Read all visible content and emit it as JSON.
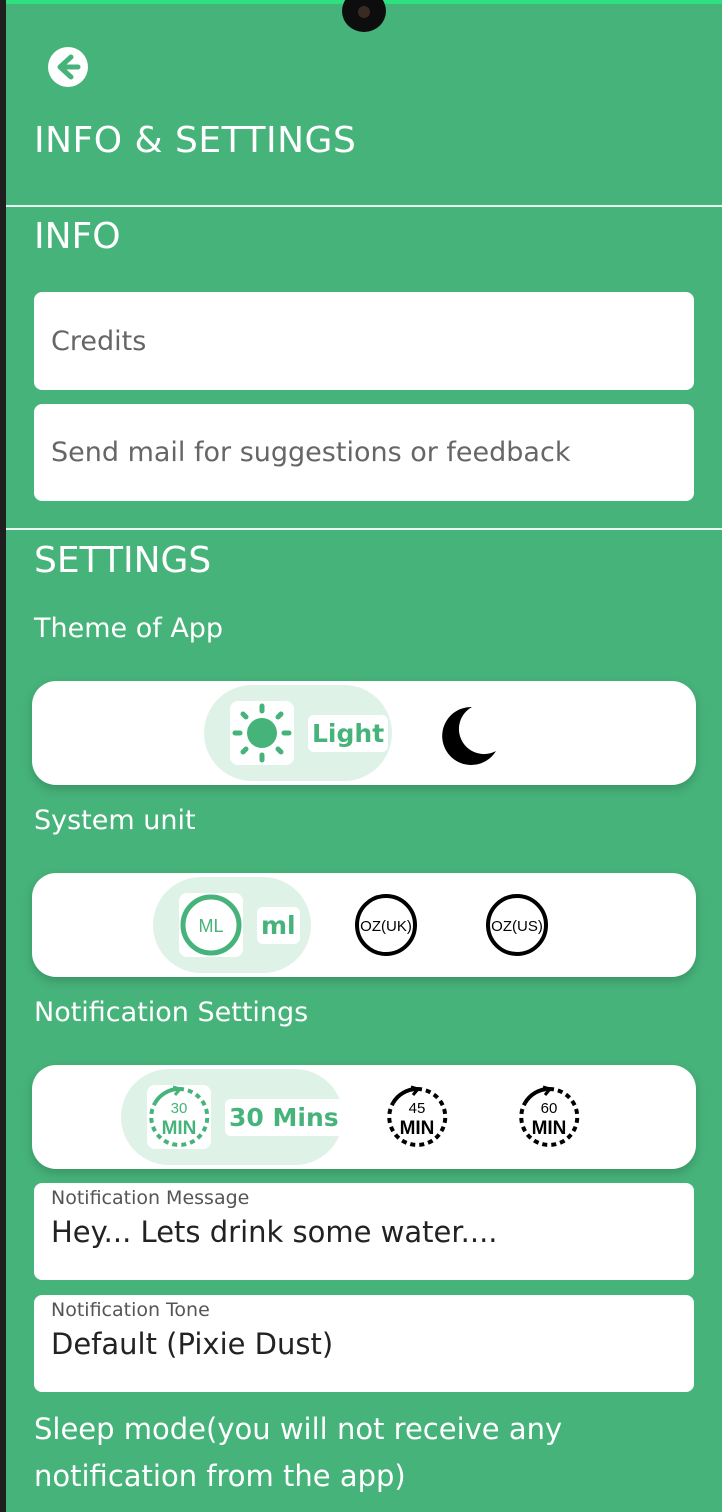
{
  "header": {
    "title": "INFO & SETTINGS"
  },
  "info": {
    "title": "INFO",
    "items": [
      {
        "label": "Credits"
      },
      {
        "label": "Send mail for suggestions or feedback"
      }
    ]
  },
  "settings": {
    "title": "SETTINGS",
    "theme": {
      "label": "Theme of App",
      "selected": "Light",
      "options": [
        "Light",
        "Dark"
      ]
    },
    "unit": {
      "label": "System unit",
      "selected": "ml",
      "options": [
        "ML",
        "OZ(UK)",
        "OZ(US)"
      ]
    },
    "notification": {
      "label": "Notification Settings",
      "selected": "30 Mins",
      "options": [
        {
          "num": "30",
          "unit": "MIN"
        },
        {
          "num": "45",
          "unit": "MIN"
        },
        {
          "num": "60",
          "unit": "MIN"
        }
      ]
    },
    "message": {
      "caption": "Notification Message",
      "value": "Hey... Lets drink some water...."
    },
    "tone": {
      "caption": "Notification Tone",
      "value": "Default (Pixie Dust)"
    },
    "sleep_label": "Sleep mode(you will not receive any notification from the app)"
  },
  "colors": {
    "background": "#46b37a",
    "accent": "#46b37a",
    "selected_pill": "#dff2e7"
  },
  "icons": {
    "back": "back-arrow-icon",
    "light": "sun-icon",
    "dark": "moon-icon"
  }
}
